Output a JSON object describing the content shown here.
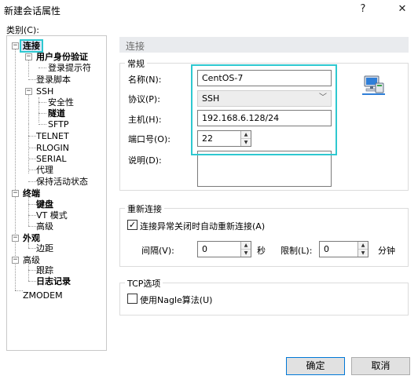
{
  "window": {
    "title": "新建会话属性",
    "help_label": "?",
    "close_label": "✕"
  },
  "category_label": "类别(C):",
  "tree": [
    {
      "label": "连接",
      "bold": true,
      "selected": true
    },
    {
      "label": "用户身份验证",
      "bold": true
    },
    {
      "label": "登录提示符",
      "bold": false
    },
    {
      "label": "登录脚本",
      "bold": false
    },
    {
      "label": "SSH",
      "bold": false
    },
    {
      "label": "安全性",
      "bold": false
    },
    {
      "label": "隧道",
      "bold": true
    },
    {
      "label": "SFTP",
      "bold": false
    },
    {
      "label": "TELNET",
      "bold": false
    },
    {
      "label": "RLOGIN",
      "bold": false
    },
    {
      "label": "SERIAL",
      "bold": false
    },
    {
      "label": "代理",
      "bold": false
    },
    {
      "label": "保持活动状态",
      "bold": false
    },
    {
      "label": "终端",
      "bold": true
    },
    {
      "label": "键盘",
      "bold": true
    },
    {
      "label": "VT 模式",
      "bold": false
    },
    {
      "label": "高级",
      "bold": false
    },
    {
      "label": "外观",
      "bold": true
    },
    {
      "label": "边距",
      "bold": false
    },
    {
      "label": "高级",
      "bold": false
    },
    {
      "label": "跟踪",
      "bold": false
    },
    {
      "label": "日志记录",
      "bold": true
    },
    {
      "label": "ZMODEM",
      "bold": false
    }
  ],
  "tree_expanders": {
    "collapse": "−"
  },
  "section_header": "连接",
  "general": {
    "title": "常规",
    "name_label": "名称(N):",
    "name_value": "CentOS-7",
    "protocol_label": "协议(P):",
    "protocol_value": "SSH",
    "host_label": "主机(H):",
    "host_value": "192.168.6.128/24",
    "port_label": "端口号(O):",
    "port_value": "22",
    "desc_label": "说明(D):",
    "desc_value": ""
  },
  "reconnect": {
    "title": "重新连接",
    "checkbox_label": "连接异常关闭时自动重新连接(A)",
    "checked": true,
    "check_mark": "✓",
    "interval_label": "间隔(V):",
    "interval_value": "0",
    "interval_unit": "秒",
    "limit_label": "限制(L):",
    "limit_value": "0",
    "limit_unit": "分钟"
  },
  "tcp": {
    "title": "TCP选项",
    "checkbox_label": "使用Nagle算法(U)",
    "checked": false
  },
  "buttons": {
    "ok": "确定",
    "cancel": "取消"
  },
  "icons": {
    "session": "network-computer-icon",
    "dropdown": "chevron-down-icon",
    "spin_up": "▲",
    "spin_down": "▼",
    "dropdown_glyph": "﹀"
  },
  "colors": {
    "highlight": "#2ec8d0",
    "primary_border": "#0078d7"
  }
}
